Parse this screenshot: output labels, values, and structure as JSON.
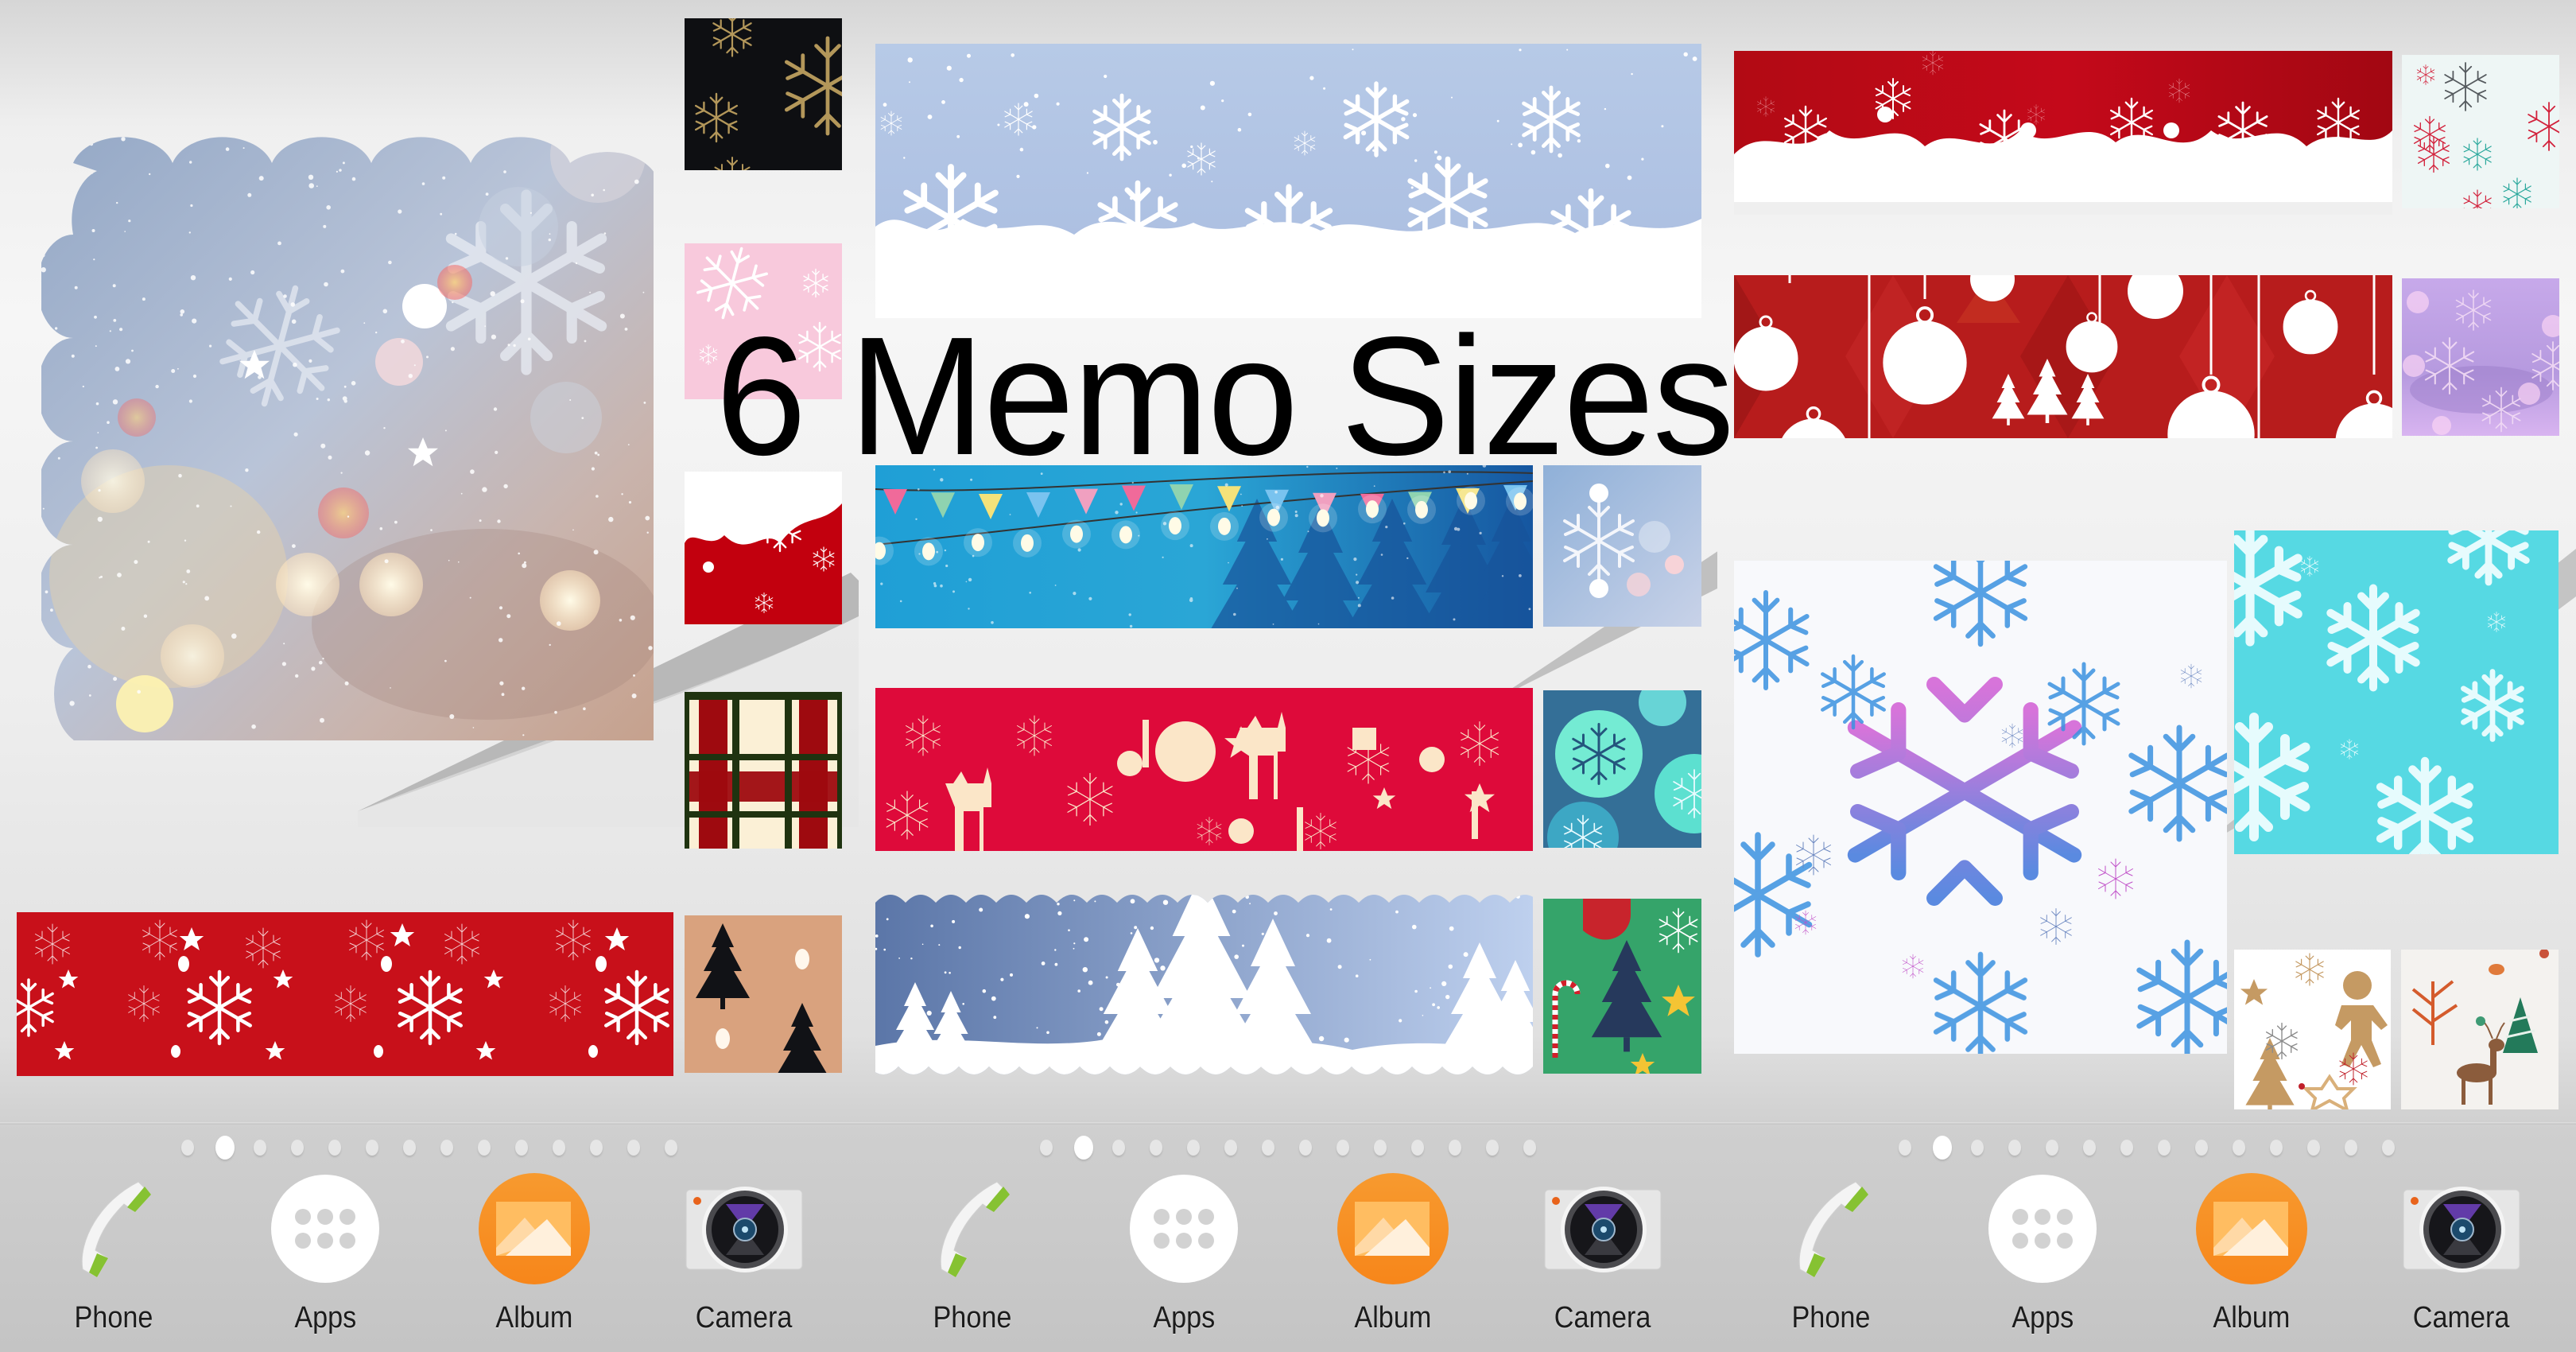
{
  "headline": "6 Memo Sizes",
  "dock": {
    "page_indicator": {
      "total_pages": 14,
      "active_page": 2
    },
    "apps": [
      {
        "label": "Phone",
        "icon": "phone-handset-icon"
      },
      {
        "label": "Apps",
        "icon": "app-drawer-grid-icon"
      },
      {
        "label": "Album",
        "icon": "album-gallery-icon"
      },
      {
        "label": "Camera",
        "icon": "camera-lens-icon"
      }
    ]
  },
  "colors": {
    "album_orange": "#f7861a",
    "phone_green": "#86c232",
    "camera_accent": "#e8631b"
  },
  "screens": [
    {
      "name": "screen-1",
      "memo_widgets": [
        {
          "size": "large-square",
          "theme": "blurred bokeh snowflakes, scalloped edge"
        },
        {
          "size": "small",
          "theme": "gold snowflakes on black"
        },
        {
          "size": "small",
          "theme": "white snowflakes on pink"
        },
        {
          "size": "small",
          "theme": "white snowflakes on red"
        },
        {
          "size": "small",
          "theme": "red and green plaid"
        },
        {
          "size": "wide-banner",
          "theme": "crumpled red paper with white snowflakes"
        },
        {
          "size": "small",
          "theme": "black trees on kraft paper"
        }
      ]
    },
    {
      "name": "screen-2",
      "memo_widgets": [
        {
          "size": "extra-wide-tall",
          "theme": "white snowflakes on light blue"
        },
        {
          "size": "wide-banner",
          "theme": "string lights and bunting over blue forest"
        },
        {
          "size": "small",
          "theme": "bokeh snowflake blue"
        },
        {
          "size": "wide-banner",
          "theme": "cream christmas icons on red"
        },
        {
          "size": "small",
          "theme": "teal ornaments"
        },
        {
          "size": "wide-banner",
          "theme": "white pine trees on blue, wavy edges"
        },
        {
          "size": "small",
          "theme": "green christmas pattern"
        }
      ]
    },
    {
      "name": "screen-3",
      "memo_widgets": [
        {
          "size": "wide-banner",
          "theme": "white snowflake garland on red"
        },
        {
          "size": "small",
          "theme": "multicolor snowflakes on white"
        },
        {
          "size": "wide-banner",
          "theme": "white baubles on red geometric"
        },
        {
          "size": "small",
          "theme": "purple bokeh snowflakes"
        },
        {
          "size": "large-square",
          "theme": "watercolor blue and violet snowflakes"
        },
        {
          "size": "medium-square",
          "theme": "white snowflakes on turquoise"
        },
        {
          "size": "tiny",
          "theme": "gingerbread and stars on white"
        },
        {
          "size": "tiny",
          "theme": "woodland deer and trees"
        }
      ]
    }
  ]
}
